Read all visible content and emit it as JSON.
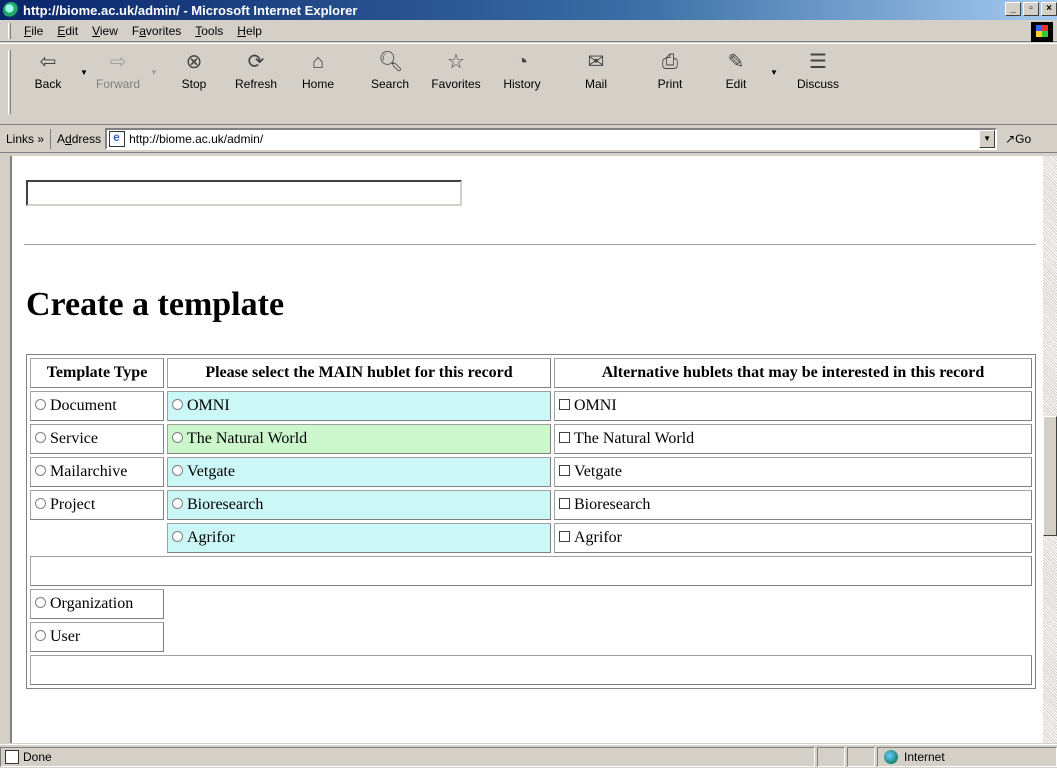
{
  "window": {
    "title": "http://biome.ac.uk/admin/ - Microsoft Internet Explorer"
  },
  "menu": [
    {
      "pre": "",
      "key": "F",
      "post": "ile"
    },
    {
      "pre": "",
      "key": "E",
      "post": "dit"
    },
    {
      "pre": "",
      "key": "V",
      "post": "iew"
    },
    {
      "pre": "F",
      "key": "a",
      "post": "vorites"
    },
    {
      "pre": "",
      "key": "T",
      "post": "ools"
    },
    {
      "pre": "",
      "key": "H",
      "post": "elp"
    }
  ],
  "toolbar": {
    "back": "Back",
    "forward": "Forward",
    "stop": "Stop",
    "refresh": "Refresh",
    "home": "Home",
    "search": "Search",
    "favorites": "Favorites",
    "history": "History",
    "mail": "Mail",
    "print": "Print",
    "edit": "Edit",
    "discuss": "Discuss"
  },
  "addressbar": {
    "links": "Links »",
    "label_pre": "A",
    "label_key": "d",
    "label_post": "dress",
    "url": "http://biome.ac.uk/admin/",
    "go": "Go"
  },
  "page": {
    "heading": "Create a template",
    "table": {
      "headers": [
        "Template Type",
        "Please select the MAIN hublet for this record",
        "Alternative hublets that may be interested in this record"
      ],
      "types": [
        "Document",
        "Service",
        "Mailarchive",
        "Project"
      ],
      "main_hublets": [
        "OMNI",
        "The Natural World",
        "Vetgate",
        "Bioresearch",
        "Agrifor"
      ],
      "alt_hublets": [
        "OMNI",
        "The Natural World",
        "Vetgate",
        "Bioresearch",
        "Agrifor"
      ],
      "extra_types": [
        "Organization",
        "User"
      ]
    }
  },
  "status": {
    "text": "Done",
    "zone": "Internet"
  },
  "colors": {
    "main_hublet_bg": "#ccf7f7",
    "highlight_bg": "#ccf7cc",
    "title_bar": "#0a246a"
  }
}
